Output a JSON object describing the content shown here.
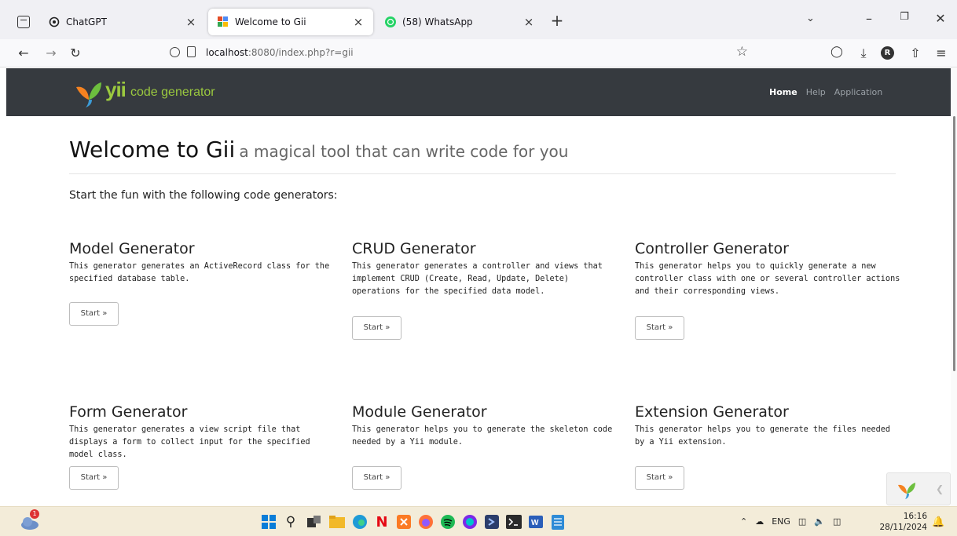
{
  "browser": {
    "tabs": [
      {
        "title": "ChatGPT",
        "close": "×",
        "favicon": "chatgpt-icon"
      },
      {
        "title": "Welcome to Gii",
        "close": "×",
        "favicon": "yii-icon"
      },
      {
        "title": "(58) WhatsApp",
        "close": "×",
        "favicon": "whatsapp-icon"
      }
    ],
    "new_tab": "+",
    "url_host": "localhost",
    "url_rest": ":8080/index.php?r=gii",
    "profile_initial": "R"
  },
  "header": {
    "logo_text": "yii",
    "subtitle": "code generator",
    "nav": {
      "home": "Home",
      "help": "Help",
      "application": "Application"
    }
  },
  "page": {
    "title": "Welcome to Gii",
    "subtitle": "a magical tool that can write code for you",
    "intro": "Start the fun with the following code generators:"
  },
  "generators": [
    {
      "title": "Model Generator",
      "description": "This generator generates an ActiveRecord class for the specified database table.",
      "button": "Start »"
    },
    {
      "title": "CRUD Generator",
      "description": "This generator generates a controller and views that implement CRUD (Create, Read, Update, Delete) operations for the specified data model.",
      "button": "Start »"
    },
    {
      "title": "Controller Generator",
      "description": "This generator helps you to quickly generate a new controller class with one or several controller actions and their corresponding views.",
      "button": "Start »"
    },
    {
      "title": "Form Generator",
      "description": "This generator generates a view script file that displays a form to collect input for the specified model class.",
      "button": "Start »"
    },
    {
      "title": "Module Generator",
      "description": "This generator helps you to generate the skeleton code needed by a Yii module.",
      "button": "Start »"
    },
    {
      "title": "Extension Generator",
      "description": "This generator helps you to generate the files needed by a Yii extension.",
      "button": "Start »"
    }
  ],
  "taskbar": {
    "weather_badge": "1",
    "language": "ENG",
    "time": "16:16",
    "date": "28/11/2024"
  },
  "colors": {
    "header_bg": "#363a3f",
    "yii_green": "#9bc93f",
    "taskbar_bg": "#f3ecd9"
  }
}
